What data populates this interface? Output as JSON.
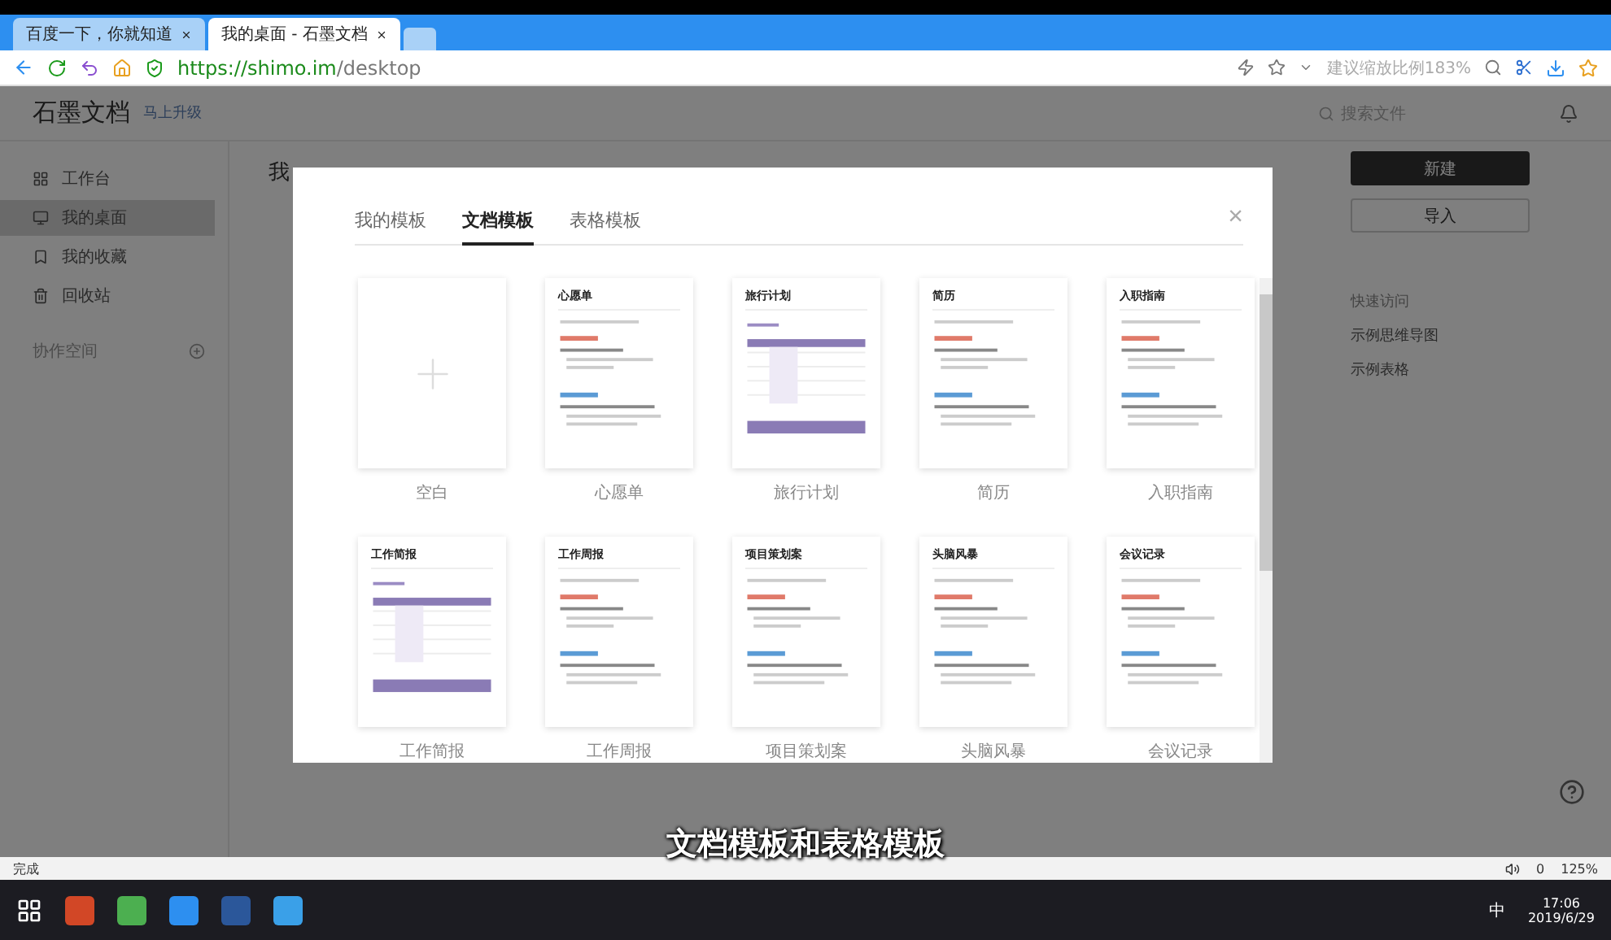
{
  "browser": {
    "tabs": [
      {
        "title": "百度一下，你就知道",
        "selected": false
      },
      {
        "title": "我的桌面 - 石墨文档",
        "selected": true
      }
    ],
    "url_host": "https://shimo.im",
    "url_path": "/desktop",
    "zoom_hint": "建议缩放比例183%"
  },
  "app": {
    "logo": "石墨文档",
    "upgrade": "马上升级",
    "search": {
      "placeholder": "搜索文件"
    },
    "sidebar": {
      "items": [
        {
          "label": "工作台",
          "selected": false
        },
        {
          "label": "我的桌面",
          "selected": true
        },
        {
          "label": "我的收藏",
          "selected": false
        },
        {
          "label": "回收站",
          "selected": false
        }
      ],
      "section": "协作空间"
    },
    "main_title": "我",
    "buttons": [
      {
        "label": "新建",
        "kind": "primary"
      },
      {
        "label": "导入",
        "kind": "secondary"
      }
    ],
    "quick_access": {
      "title": "快速访问",
      "items": [
        "示例思维导图",
        "示例表格"
      ]
    }
  },
  "modal": {
    "tabs": [
      {
        "label": "我的模板",
        "selected": false
      },
      {
        "label": "文档模板",
        "selected": true
      },
      {
        "label": "表格模板",
        "selected": false
      }
    ],
    "close": "×",
    "templates": [
      {
        "name": "空白",
        "kind": "blank"
      },
      {
        "name": "心愿单",
        "kind": "doc",
        "heading": "心愿单"
      },
      {
        "name": "旅行计划",
        "kind": "table",
        "heading": "旅行计划"
      },
      {
        "name": "简历",
        "kind": "doc",
        "heading": "简历"
      },
      {
        "name": "入职指南",
        "kind": "doc",
        "heading": "入职指南"
      },
      {
        "name": "工作简报",
        "kind": "table",
        "heading": "工作简报"
      },
      {
        "name": "工作周报",
        "kind": "doc",
        "heading": "工作周报"
      },
      {
        "name": "项目策划案",
        "kind": "doc",
        "heading": "项目策划案"
      },
      {
        "name": "头脑风暴",
        "kind": "doc",
        "heading": "头脑风暴"
      },
      {
        "name": "会议记录",
        "kind": "doc",
        "heading": "会议记录"
      }
    ]
  },
  "subtitle": "文档模板和表格模板",
  "status_bar": {
    "text": "完成",
    "count": "0",
    "zoom": "125%"
  },
  "taskbar": {
    "ime": "中",
    "time": "17:06",
    "date": "2019/6/29"
  }
}
